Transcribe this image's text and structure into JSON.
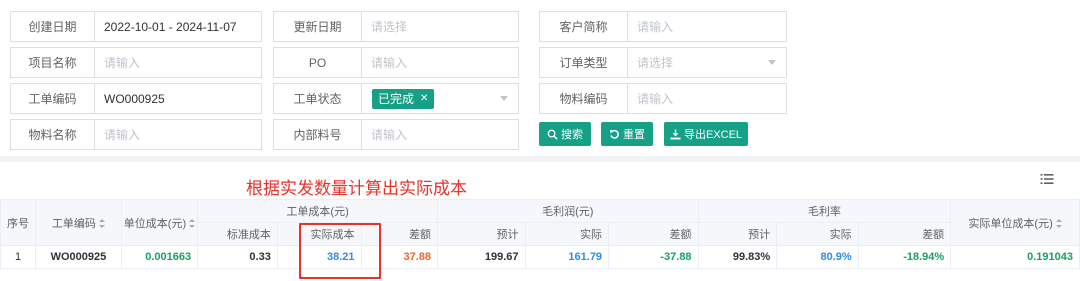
{
  "filters": {
    "created_date": {
      "label": "创建日期",
      "value": "2022-10-01 - 2024-11-07"
    },
    "updated_date": {
      "label": "更新日期",
      "placeholder": "请选择"
    },
    "customer_short": {
      "label": "客户简称",
      "placeholder": "请输入"
    },
    "project_name": {
      "label": "项目名称",
      "placeholder": "请输入"
    },
    "po": {
      "label": "PO",
      "placeholder": "请输入"
    },
    "order_type": {
      "label": "订单类型",
      "placeholder": "请选择"
    },
    "work_order_code": {
      "label": "工单编码",
      "value": "WO000925"
    },
    "work_order_status": {
      "label": "工单状态",
      "tag": "已完成"
    },
    "material_code": {
      "label": "物料编码",
      "placeholder": "请输入"
    },
    "material_name": {
      "label": "物料名称",
      "placeholder": "请输入"
    },
    "internal_part_no": {
      "label": "内部料号",
      "placeholder": "请输入"
    }
  },
  "buttons": {
    "search": "搜索",
    "reset": "重置",
    "export": "导出EXCEL"
  },
  "annotation": "根据实发数量计算出实际成本",
  "table": {
    "headers": {
      "seq": "序号",
      "wo_code": "工单编码",
      "unit_cost": "单位成本(元)",
      "wo_cost_group": "工单成本(元)",
      "std_cost": "标准成本",
      "actual_cost": "实际成本",
      "diff": "差额",
      "gross_profit_group": "毛利润(元)",
      "estimate": "预计",
      "actual": "实际",
      "gp_diff": "差额",
      "margin_group": "毛利率",
      "m_estimate": "预计",
      "m_actual": "实际",
      "m_diff": "差额",
      "actual_unit_cost": "实际单位成本(元)"
    },
    "rows": [
      {
        "seq": "1",
        "wo_code": "WO000925",
        "unit_cost": "0.001663",
        "std_cost": "0.33",
        "actual_cost": "38.21",
        "diff": "37.88",
        "gp_estimate": "199.67",
        "gp_actual": "161.79",
        "gp_diff": "-37.88",
        "m_estimate": "99.83%",
        "m_actual": "80.9%",
        "m_diff": "-18.94%",
        "actual_unit_cost": "0.191043"
      }
    ]
  },
  "colors": {
    "primary": "#16a085",
    "annotation_red": "#e8322a",
    "value_blue": "#2d8cf0",
    "value_green": "#19a15f",
    "value_orange": "#f5612a"
  }
}
